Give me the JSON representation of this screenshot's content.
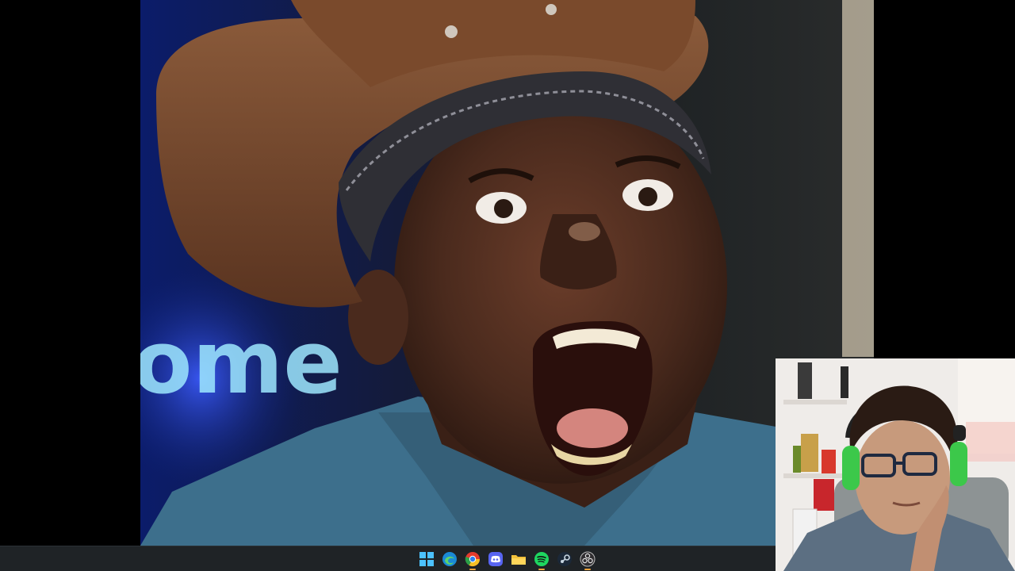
{
  "screen": {
    "description_free": true
  },
  "main_image": {
    "neon_sign_text": "ome"
  },
  "taskbar": {
    "icons": [
      {
        "name": "start-icon",
        "active": false
      },
      {
        "name": "edge-icon",
        "active": false
      },
      {
        "name": "chrome-icon",
        "active": true
      },
      {
        "name": "discord-icon",
        "active": false
      },
      {
        "name": "file-explorer-icon",
        "active": false
      },
      {
        "name": "spotify-icon",
        "active": true
      },
      {
        "name": "steam-icon",
        "active": false
      },
      {
        "name": "obs-icon",
        "active": true
      }
    ]
  },
  "colors": {
    "taskbar_bg": "#1f2326",
    "active_indicator": "#f2a33a",
    "neon": "#9ee8ff"
  }
}
